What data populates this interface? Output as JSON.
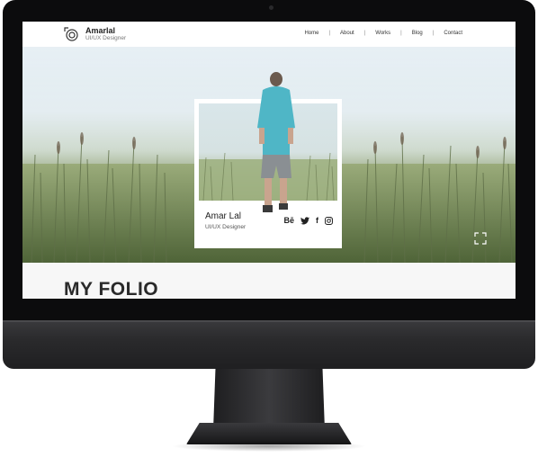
{
  "site": {
    "brand": "Amarlal",
    "tagline": "UI/UX Designer"
  },
  "nav": {
    "items": [
      {
        "label": "Home"
      },
      {
        "label": "About"
      },
      {
        "label": "Works"
      },
      {
        "label": "Blog"
      },
      {
        "label": "Contact"
      }
    ],
    "separator": "|"
  },
  "card": {
    "name": "Amar Lal",
    "role": "UI/UX Designer",
    "social": [
      {
        "icon": "behance-icon",
        "glyph": "Bē"
      },
      {
        "icon": "twitter-icon",
        "glyph": "🐦"
      },
      {
        "icon": "facebook-icon",
        "glyph": "f"
      },
      {
        "icon": "instagram-icon",
        "glyph": "◎"
      }
    ]
  },
  "section": {
    "title": "MY FOLIO"
  },
  "colors": {
    "bezel": "#0c0c0d",
    "text": "#222222",
    "accent_shirt": "#4fb6c6"
  }
}
